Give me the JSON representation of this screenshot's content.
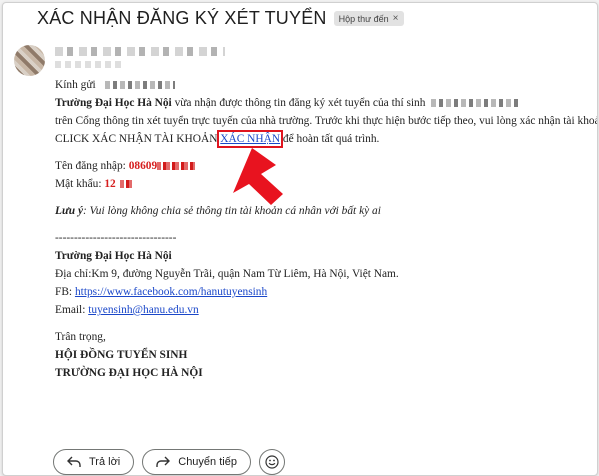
{
  "email": {
    "subject": "XÁC NHẬN ĐĂNG KÝ XÉT TUYỂN",
    "label": "Hộp thư đến",
    "label_close": "×"
  },
  "body": {
    "greeting": "Kính gửi",
    "line1_bold": "Trường Đại Học Hà Nội",
    "line1_rest": " vừa nhận được thông tin đăng ký xét tuyển của thí sinh",
    "line2": "trên Cổng thông tin xét tuyển trực tuyến của nhà trường. Trước khi thực hiện bước tiếp theo, vui lòng xác nhận tài khoản.",
    "click_text": " CLICK XÁC NHẬN TÀI KHOẢN ",
    "confirm_link": "XÁC NHẬN",
    "click_after": " để hoàn tất quá trình.",
    "username_label": "Tên đăng nhập: ",
    "username_value": "08609",
    "password_label": "Mật khẩu: ",
    "password_value": "12",
    "note_label": "Lưu ý",
    "note_text": ": Vui lòng không chia sẻ thông tin tài khoản cá nhân với bất kỳ ai",
    "divider": "--------------------------------",
    "sig_name": "Trường Đại Học Hà Nội",
    "sig_address": "Địa chỉ:Km 9, đường Nguyễn Trãi, quận Nam Từ Liêm, Hà Nội, Việt Nam.",
    "sig_fb_label": "FB: ",
    "sig_fb_link": "https://www.facebook.com/hanutuyensinh",
    "sig_email_label": "Email: ",
    "sig_email_link": "tuyensinh@hanu.edu.vn",
    "closing": "Trân trọng,",
    "council": "HỘI ĐỒNG TUYỂN SINH",
    "university": "TRƯỜNG ĐẠI HỌC HÀ NỘI"
  },
  "actions": {
    "reply": "Trả lời",
    "forward": "Chuyển tiếp"
  },
  "icons": {
    "reply": "reply-icon",
    "forward": "forward-icon",
    "emoji": "emoji-icon",
    "label_close": "close-icon",
    "annotation": "red-arrow-icon"
  },
  "colors": {
    "link": "#1a47c9",
    "highlight": "#e0151f",
    "credential": "#d61f1f"
  }
}
